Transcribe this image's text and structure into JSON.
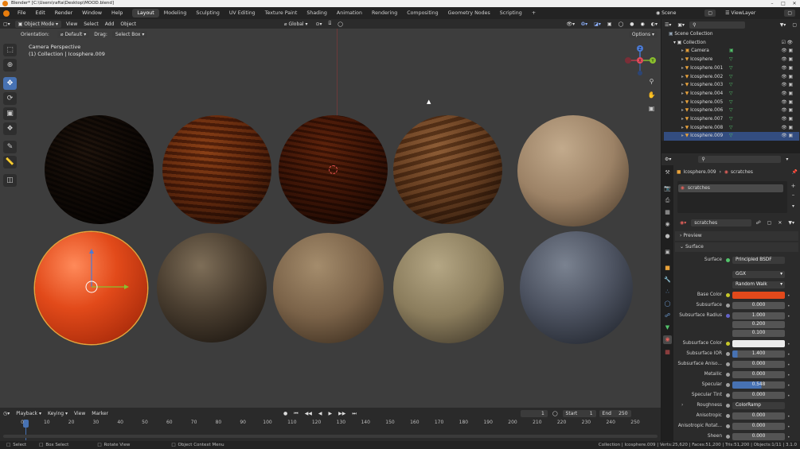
{
  "window": {
    "title": "Blender* [C:\\Users\\rafta\\Desktop\\MOOD.blend]"
  },
  "menus": [
    "File",
    "Edit",
    "Render",
    "Window",
    "Help"
  ],
  "workspaces": [
    "Layout",
    "Modeling",
    "Sculpting",
    "UV Editing",
    "Texture Paint",
    "Shading",
    "Animation",
    "Rendering",
    "Compositing",
    "Geometry Nodes",
    "Scripting"
  ],
  "scene": {
    "label": "Scene",
    "view_layer": "ViewLayer"
  },
  "viewport_header": {
    "mode": "Object Mode",
    "items": [
      "View",
      "Select",
      "Add",
      "Object"
    ],
    "orientation_global": "Global",
    "options": "Options"
  },
  "viewport_header2": {
    "orientation_label": "Orientation:",
    "orientation_value": "Default",
    "drag_label": "Drag:",
    "drag_value": "Select Box"
  },
  "viewport": {
    "camera_text": "Camera Perspective",
    "collection_text": "(1) Collection | Icosphere.009"
  },
  "gizmo": {
    "x": "X",
    "y": "Y",
    "z": "Z"
  },
  "timeline": {
    "menus": [
      "Playback",
      "Keying",
      "View",
      "Marker"
    ],
    "current_frame": "1",
    "start_label": "Start",
    "start": "1",
    "end_label": "End",
    "end": "250",
    "frame_labels": [
      "0",
      "10",
      "20",
      "30",
      "40",
      "50",
      "60",
      "70",
      "80",
      "90",
      "100",
      "110",
      "120",
      "130",
      "140",
      "150",
      "160",
      "170",
      "180",
      "190",
      "200",
      "210",
      "220",
      "230",
      "240",
      "250"
    ]
  },
  "statusbar": {
    "select": "Select",
    "box_select": "Box Select",
    "rotate": "Rotate View",
    "context": "Object Context Menu",
    "info": "Collection | Icosphere.009 | Verts:25,620 | Faces:51,200 | Tris:51,200 | Objects:1/11 | 3.1.0"
  },
  "outliner": {
    "scene_collection": "Scene Collection",
    "collection": "Collection",
    "items": [
      "Camera",
      "Icosphere",
      "Icosphere.001",
      "Icosphere.002",
      "Icosphere.003",
      "Icosphere.004",
      "Icosphere.005",
      "Icosphere.006",
      "Icosphere.007",
      "Icosphere.008",
      "Icosphere.009"
    ],
    "selected": "Icosphere.009"
  },
  "properties": {
    "object": "Icosphere.009",
    "material": "scratches",
    "slot": "scratches",
    "material_name": "scratches",
    "preview": "Preview",
    "surface_panel": "Surface",
    "surface_label": "Surface",
    "surface_value": "Principled BSDF",
    "distribution": "GGX",
    "subsurface_method": "Random Walk",
    "base_color_label": "Base Color",
    "base_color": "#e2491b",
    "subsurface_label": "Subsurface",
    "subsurface": "0.000",
    "radius_label": "Subsurface Radius",
    "radius": [
      "1.000",
      "0.200",
      "0.100"
    ],
    "ss_color_label": "Subsurface Color",
    "ss_color": "#ececec",
    "ss_ior_label": "Subsurface IOR",
    "ss_ior": "1.400",
    "ss_aniso_label": "Subsurface Aniso...",
    "ss_aniso": "0.000",
    "metallic_label": "Metallic",
    "metallic": "0.000",
    "specular_label": "Specular",
    "specular": "0.548",
    "spec_tint_label": "Specular Tint",
    "spec_tint": "0.000",
    "roughness_label": "Roughness",
    "roughness": "ColorRamp",
    "aniso_label": "Anisotropic",
    "aniso": "0.000",
    "aniso_rot_label": "Anisotropic Rotat...",
    "aniso_rot": "0.000",
    "sheen_label": "Sheen",
    "sheen": "0.000"
  },
  "colors": {
    "accent": "#4772b3",
    "selection": "#e8a33a",
    "base_color": "#e2491b"
  }
}
